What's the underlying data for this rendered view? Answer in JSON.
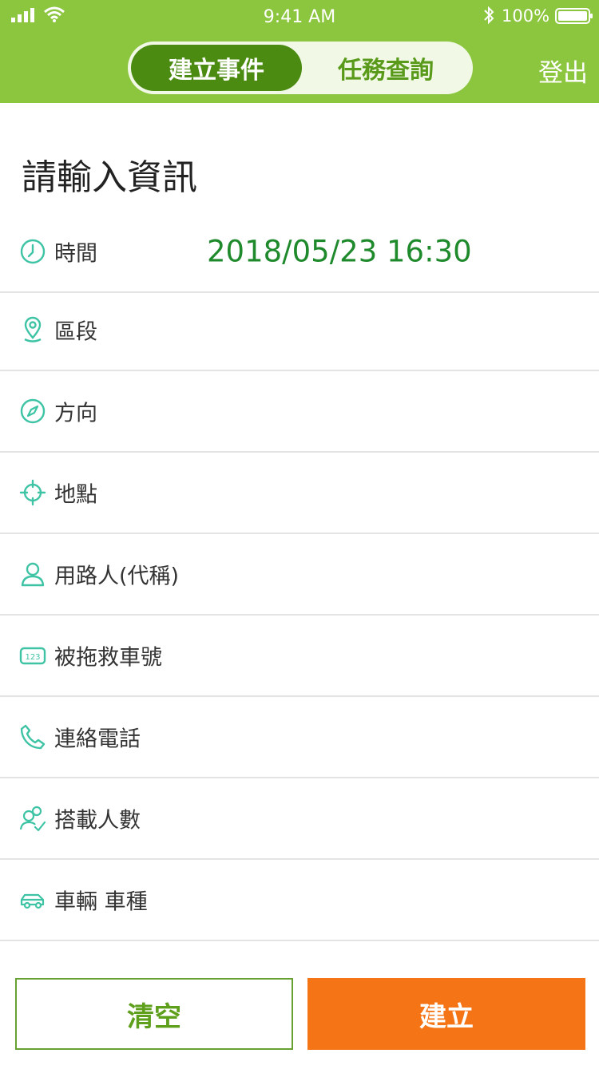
{
  "status_bar": {
    "time": "9:41 AM",
    "battery": "100%"
  },
  "header": {
    "tabs": [
      {
        "label": "建立事件",
        "active": true
      },
      {
        "label": "任務查詢",
        "active": false
      }
    ],
    "logout_label": "登出"
  },
  "form": {
    "title": "請輸入資訊",
    "fields": [
      {
        "label": "時間",
        "value": "2018/05/23 16:30",
        "icon": "clock-icon"
      },
      {
        "label": "區段",
        "value": "",
        "icon": "location-pin-icon"
      },
      {
        "label": "方向",
        "value": "",
        "icon": "compass-icon"
      },
      {
        "label": "地點",
        "value": "",
        "icon": "crosshair-icon"
      },
      {
        "label": "用路人(代稱)",
        "value": "",
        "icon": "person-icon"
      },
      {
        "label": "被拖救車號",
        "value": "",
        "icon": "license-plate-icon"
      },
      {
        "label": "連絡電話",
        "value": "",
        "icon": "phone-icon"
      },
      {
        "label": "搭載人數",
        "value": "",
        "icon": "passengers-icon"
      },
      {
        "label": "車輛 車種",
        "value": "",
        "icon": "car-icon"
      }
    ]
  },
  "actions": {
    "clear_label": "清空",
    "create_label": "建立"
  },
  "colors": {
    "header": "#8cc63e",
    "active_tab": "#4b8b11",
    "icon": "#3ec4a5",
    "value_text": "#1f8a2c",
    "create_button": "#f57416",
    "clear_border": "#66a132"
  }
}
